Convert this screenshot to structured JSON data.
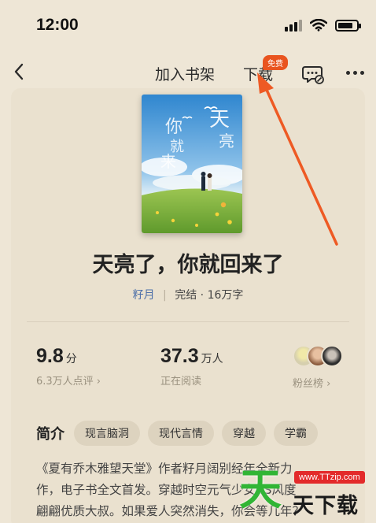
{
  "status_bar": {
    "time": "12:00"
  },
  "nav": {
    "add_shelf": "加入书架",
    "download": "下载",
    "free_badge": "免费"
  },
  "book": {
    "cover_title": "天亮了你就回来了",
    "title": "天亮了，你就回来了",
    "author": "籽月",
    "separator": "|",
    "status": "完结 · 16万字"
  },
  "stats": {
    "rating": {
      "value": "9.8",
      "unit": "分",
      "sub": "6.3万人点评 ›"
    },
    "reading": {
      "value": "37.3",
      "unit": "万人",
      "sub": "正在阅读"
    },
    "fans": {
      "label": "粉丝榜 ›"
    }
  },
  "intro": {
    "label": "简介",
    "tags": [
      "现言脑洞",
      "现代言情",
      "穿越",
      "学霸"
    ],
    "lines": [
      "《夏有乔木雅望天堂》作者籽月阔别经年全新力",
      "作，电子书全文首发。穿越时空元气少女VS风度",
      "翩翩优质大叔。如果爱人突然消失，你会等几年？"
    ]
  },
  "watermark": {
    "big": "天",
    "url": "www.TTzip.com",
    "small": "天下载"
  },
  "colors": {
    "background": "#eee6d6",
    "accent": "#e9541f",
    "author_link": "#4b6ea8",
    "arrow": "#ee5a24"
  }
}
